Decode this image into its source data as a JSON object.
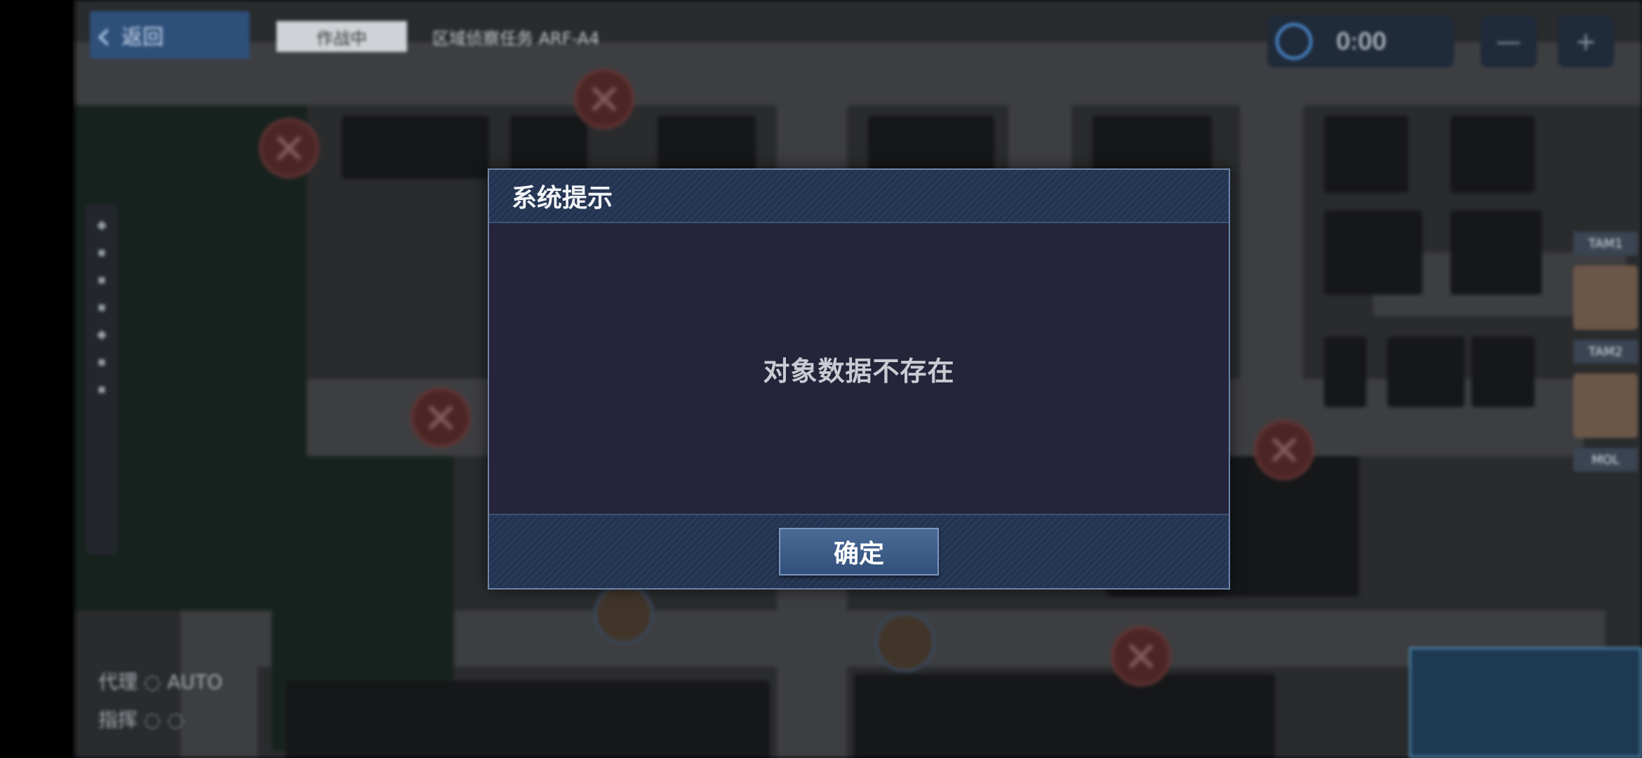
{
  "hud": {
    "back_label": "返回",
    "tag_label": "作战中",
    "mission_label": "区域侦察任务 ARF-A4",
    "timer_label": "0:00",
    "round_button_1": "—",
    "round_button_2": "+"
  },
  "side_panel": {
    "items": [
      "◆",
      "▪",
      "▪",
      "▪",
      "◆",
      "▪",
      "▪"
    ]
  },
  "bottom_left": {
    "line1": "代理 ◌ AUTO",
    "line2": "指挥 ◌ ◌"
  },
  "right_panel": {
    "labels": [
      "TAM1",
      "TAM2",
      "MOL"
    ]
  },
  "dialog": {
    "title": "系统提示",
    "message": "对象数据不存在",
    "confirm_label": "确定"
  },
  "colors": {
    "dialog_header": "#233452",
    "dialog_body": "#25243a",
    "confirm_button": "#3d5c88"
  }
}
